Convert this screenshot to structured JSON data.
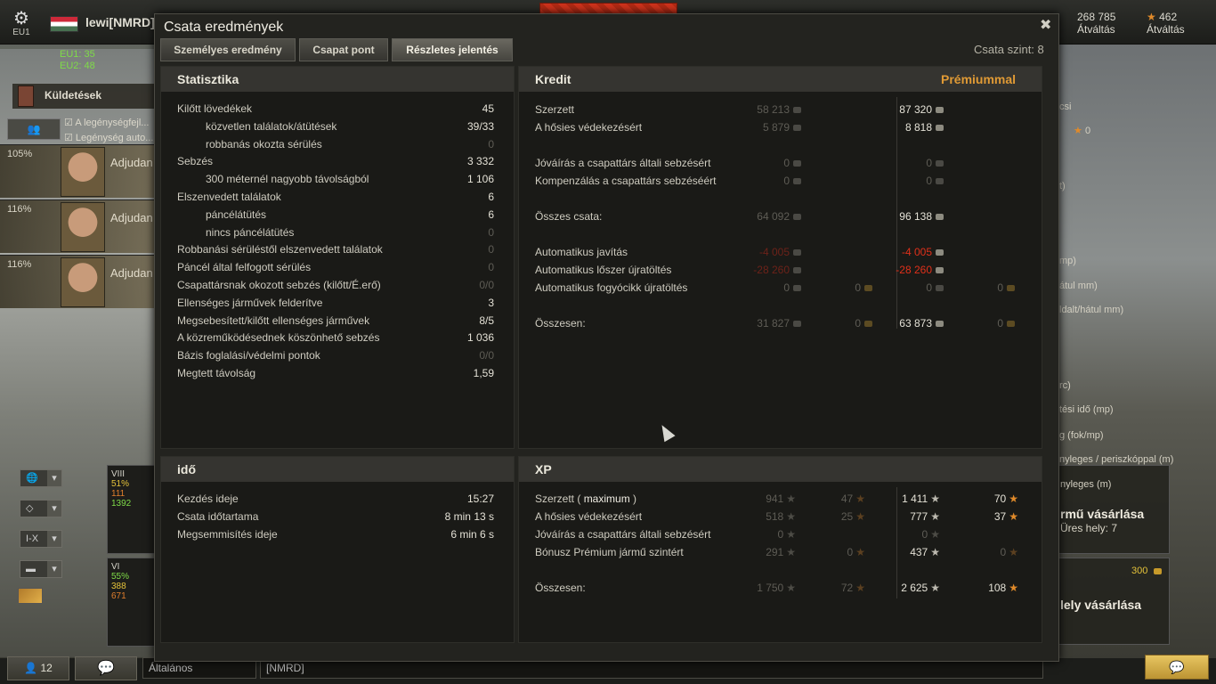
{
  "topbar": {
    "server": "EU1",
    "player": "lewi[NMRD]",
    "credits": "268 785",
    "credits_label": "Átváltás",
    "gold": "462",
    "gold_label": "Átváltás"
  },
  "left": {
    "srv1": "EU1: 35",
    "srv2": "EU2: 48",
    "missions": "Küldetések",
    "chk1": "A legénységfejl...",
    "chk2": "Legénység auto...",
    "crew": [
      {
        "pct": "105%",
        "rank": "Adjudan"
      },
      {
        "pct": "116%",
        "rank": "Adjudan"
      },
      {
        "pct": "116%",
        "rank": "Adjudan"
      }
    ],
    "filters": [
      "",
      "",
      "I-X",
      ""
    ],
    "tanks": [
      {
        "tier": "VIII",
        "a": "51%",
        "b": "111",
        "c": "1392"
      },
      {
        "tier": "VI",
        "a": "55%",
        "b": "388",
        "c": "671"
      }
    ]
  },
  "bottom": {
    "players": "12",
    "chat1": "Általános",
    "chat2": "[NMRD]"
  },
  "right": {
    "labels": [
      "csi",
      "0",
      "t)",
      "mp)",
      "átul mm)",
      "ldalt/hátul mm)",
      "rc)",
      "tési idő (mp)",
      "g (fok/mp)",
      "nyleges / periszkóppal (m)",
      "nyleges (m)"
    ],
    "buy1_title": "rmű vásárlása",
    "buy1_sub": "Üres hely: 7",
    "buy2_price": "300",
    "buy2_title": "lely vásárlása"
  },
  "modal": {
    "title": "Csata eredmények",
    "tabs": [
      "Személyes eredmény",
      "Csapat pont",
      "Részletes jelentés"
    ],
    "level": "Csata szint: 8",
    "stats": {
      "header": "Statisztika",
      "rows": [
        {
          "l": "Kilőtt lövedékek",
          "v": "45",
          "i": 0,
          "d": false
        },
        {
          "l": "közvetlen találatok/átütések",
          "v": "39/33",
          "i": 1,
          "d": false
        },
        {
          "l": "robbanás okozta sérülés",
          "v": "0",
          "i": 1,
          "d": true
        },
        {
          "l": "Sebzés",
          "v": "3 332",
          "i": 0,
          "d": false
        },
        {
          "l": "300 méternél nagyobb távolságból",
          "v": "1 106",
          "i": 1,
          "d": false
        },
        {
          "l": "Elszenvedett találatok",
          "v": "6",
          "i": 0,
          "d": false
        },
        {
          "l": "páncélátütés",
          "v": "6",
          "i": 1,
          "d": false
        },
        {
          "l": "nincs páncélátütés",
          "v": "0",
          "i": 1,
          "d": true
        },
        {
          "l": "Robbanási sérüléstől elszenvedett találatok",
          "v": "0",
          "i": 0,
          "d": true
        },
        {
          "l": "Páncél által felfogott sérülés",
          "v": "0",
          "i": 0,
          "d": true
        },
        {
          "l": "Csapattársnak okozott sebzés (kilőtt/É.erő)",
          "v": "0/0",
          "i": 0,
          "d": true
        },
        {
          "l": "Ellenséges járművek felderítve",
          "v": "3",
          "i": 0,
          "d": false
        },
        {
          "l": "Megsebesített/kilőtt ellenséges járművek",
          "v": "8/5",
          "i": 0,
          "d": false
        },
        {
          "l": "A közreműködésednek köszönhető sebzés",
          "v": "1 036",
          "i": 0,
          "d": false
        },
        {
          "l": "Bázis foglalási/védelmi pontok",
          "v": "0/0",
          "i": 0,
          "d": true
        },
        {
          "l": "Megtett távolság",
          "v": "1,59",
          "i": 0,
          "d": false
        }
      ]
    },
    "credit": {
      "header": "Kredit",
      "premium": "Prémiummal",
      "rows": [
        {
          "l": "Szerzett",
          "b": "58 213",
          "bg": "",
          "p": "87 320",
          "pg": "",
          "gap": false,
          "red": false
        },
        {
          "l": "A hősies védekezésért",
          "b": "5 879",
          "bg": "",
          "p": "8 818",
          "pg": "",
          "gap": false,
          "red": false
        },
        {
          "l": "Jóváírás a csapattárs általi sebzésért",
          "b": "0",
          "bg": "",
          "p": "0",
          "pg": "",
          "gap": true,
          "red": false,
          "dim": true
        },
        {
          "l": "Kompenzálás a csapattárs sebzéséért",
          "b": "0",
          "bg": "",
          "p": "0",
          "pg": "",
          "gap": false,
          "red": false,
          "dim": true
        },
        {
          "l": "Összes csata:",
          "b": "64 092",
          "bg": "",
          "p": "96 138",
          "pg": "",
          "gap": true,
          "red": false
        },
        {
          "l": "Automatikus javítás",
          "b": "-4 005",
          "bg": "",
          "p": "-4 005",
          "pg": "",
          "gap": true,
          "red": true
        },
        {
          "l": "Automatikus lőszer újratöltés",
          "b": "-28 260",
          "bg": "",
          "p": "-28 260",
          "pg": "",
          "gap": false,
          "red": true
        },
        {
          "l": "Automatikus fogyócikk újratöltés",
          "b": "0",
          "bg": "0",
          "p": "0",
          "pg": "0",
          "gap": false,
          "red": false,
          "dim": true
        },
        {
          "l": "Összesen:",
          "b": "31 827",
          "bg": "0",
          "p": "63 873",
          "pg": "0",
          "gap": true,
          "red": false
        }
      ]
    },
    "time": {
      "header": "idő",
      "rows": [
        {
          "l": "Kezdés ideje",
          "v": "15:27"
        },
        {
          "l": "Csata időtartama",
          "v": "8 min 13 s"
        },
        {
          "l": "Megsemmisítés ideje",
          "v": "6 min 6 s"
        }
      ]
    },
    "xp": {
      "header": "XP",
      "earned_prefix": "Szerzett (",
      "earned_max": "maximum",
      "earned_suffix": ")",
      "rows": [
        {
          "l": "Szerzett",
          "b": "941",
          "bf": "47",
          "p": "1 411",
          "pf": "70",
          "gap": false
        },
        {
          "l": "A hősies védekezésért",
          "b": "518",
          "bf": "25",
          "p": "777",
          "pf": "37",
          "gap": false
        },
        {
          "l": "Jóváírás a csapattárs általi sebzésért",
          "b": "0",
          "bf": "",
          "p": "0",
          "pf": "",
          "gap": false,
          "dim": true
        },
        {
          "l": "Bónusz Prémium jármű szintért",
          "b": "291",
          "bf": "0",
          "p": "437",
          "pf": "0",
          "gap": false
        },
        {
          "l": "Összesen:",
          "b": "1 750",
          "bf": "72",
          "p": "2 625",
          "pf": "108",
          "gap": true
        }
      ]
    }
  }
}
